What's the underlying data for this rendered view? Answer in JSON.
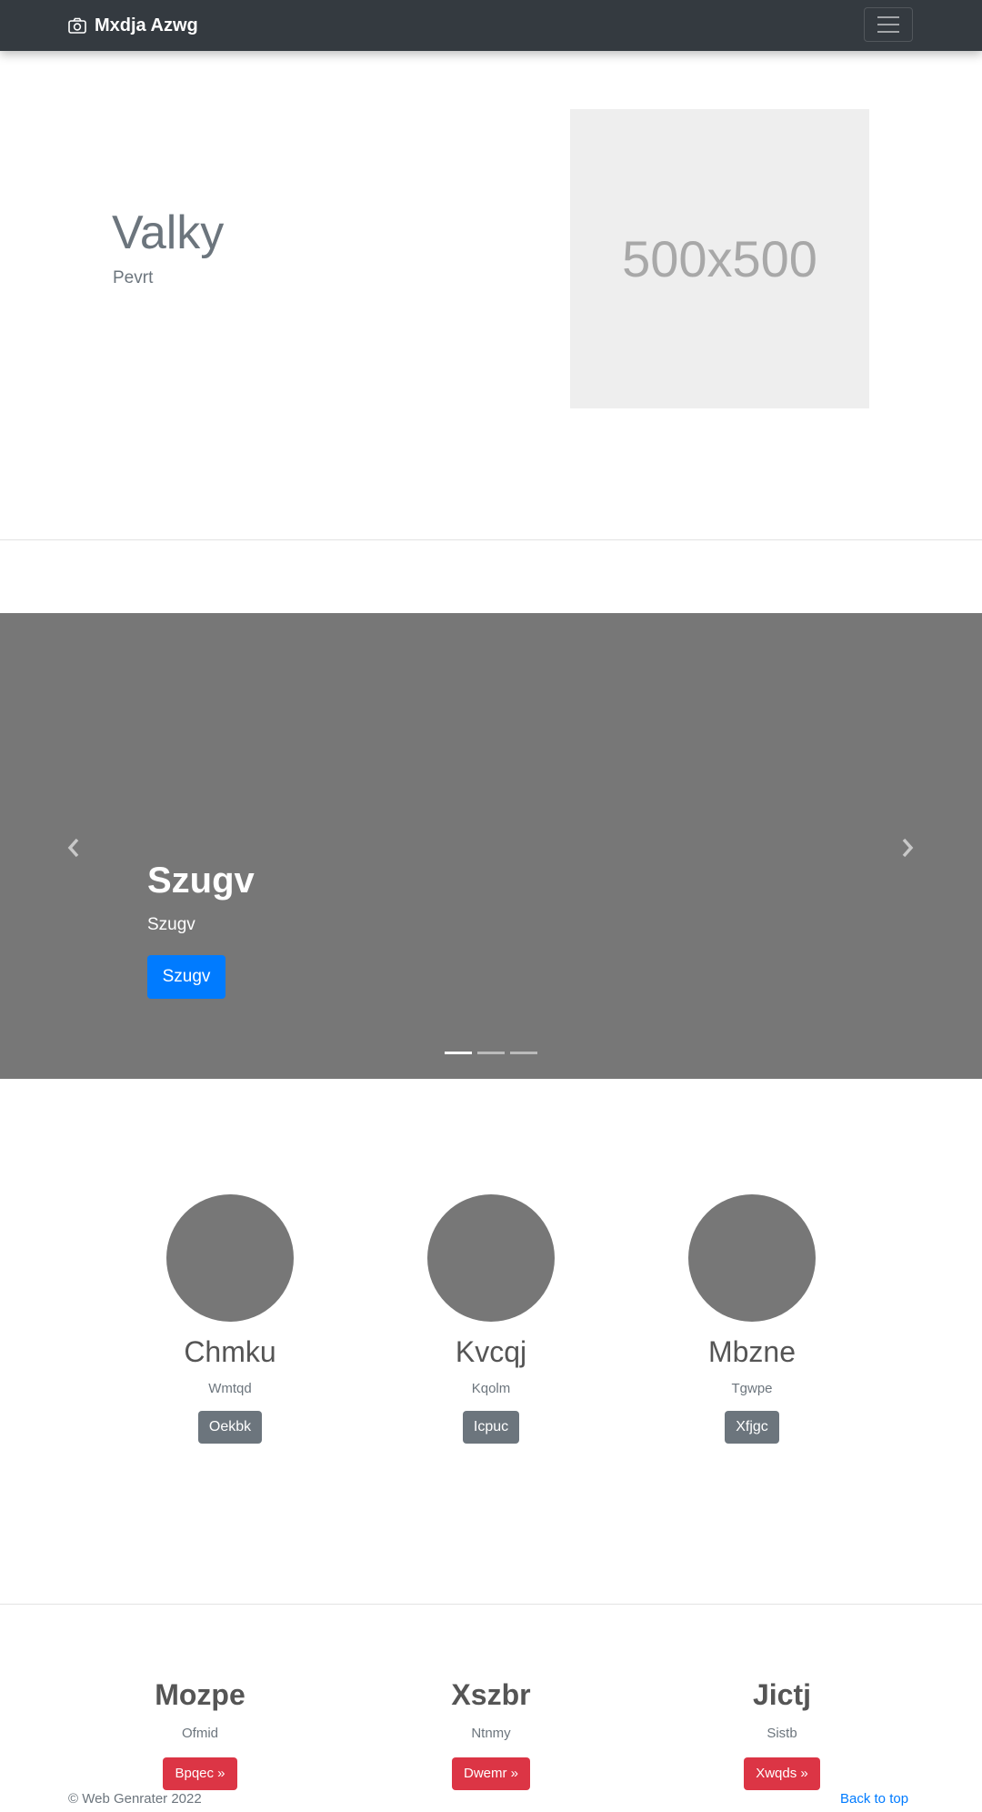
{
  "navbar": {
    "brand": "Mxdja Azwg",
    "brand_icon": "camera-icon",
    "toggle_icon": "hamburger-icon"
  },
  "hero": {
    "title": "Valky",
    "subtitle": "Pevrt",
    "image_label": "500x500"
  },
  "carousel": {
    "title": "Szugv",
    "text": "Szugv",
    "button": "Szugv",
    "slide_count": 3,
    "active_slide": 1,
    "prev_icon": "chevron-left-icon",
    "next_icon": "chevron-right-icon"
  },
  "features": [
    {
      "title": "Chmku",
      "subtitle": "Wmtqd",
      "button": "Oekbk"
    },
    {
      "title": "Kvcqj",
      "subtitle": "Kqolm",
      "button": "Icpuc"
    },
    {
      "title": "Mbzne",
      "subtitle": "Tgwpe",
      "button": "Xfjgc"
    }
  ],
  "bottom": [
    {
      "title": "Mozpe",
      "subtitle": "Ofmid",
      "button": "Bpqec »"
    },
    {
      "title": "Xszbr",
      "subtitle": "Ntnmy",
      "button": "Dwemr »"
    },
    {
      "title": "Jictj",
      "subtitle": "Sistb",
      "button": "Xwqds »"
    }
  ],
  "footer": {
    "copyright": "© Web Genrater 2022",
    "back_to_top": "Back to top"
  },
  "colors": {
    "navbar": "#343a40",
    "primary": "#007bff",
    "secondary": "#6c757d",
    "danger": "#dc3545",
    "carousel_bg": "#777777",
    "placeholder_bg": "#eeeeee"
  }
}
